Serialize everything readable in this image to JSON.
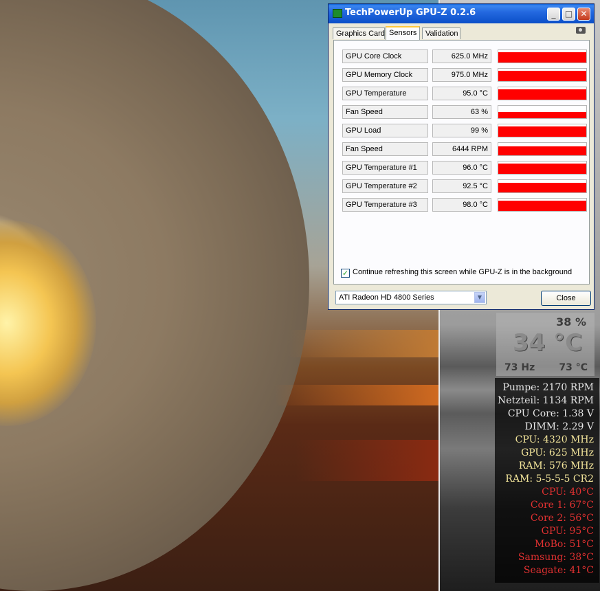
{
  "window": {
    "title": "TechPowerUp GPU-Z 0.2.6",
    "tabs": [
      "Graphics Card",
      "Sensors",
      "Validation"
    ],
    "active_tab": "Sensors",
    "sensors": [
      {
        "name": "GPU Core Clock",
        "value": "625.0 MHz",
        "level": 1.0
      },
      {
        "name": "GPU Memory Clock",
        "value": "975.0 MHz",
        "level": 1.0
      },
      {
        "name": "GPU Temperature",
        "value": "95.0 °C",
        "level": 1.0
      },
      {
        "name": "Fan Speed",
        "value": "63 %",
        "level": 0.6
      },
      {
        "name": "GPU Load",
        "value": "99 %",
        "level": 1.0
      },
      {
        "name": "Fan Speed",
        "value": "6444 RPM",
        "level": 0.85
      },
      {
        "name": "GPU Temperature #1",
        "value": "96.0 °C",
        "level": 1.0
      },
      {
        "name": "GPU Temperature #2",
        "value": "92.5 °C",
        "level": 0.9
      },
      {
        "name": "GPU Temperature #3",
        "value": "98.0 °C",
        "level": 1.0
      }
    ],
    "refresh_checkbox": {
      "label": "Continue refreshing this screen while GPU-Z is in the background",
      "checked": true
    },
    "gpu_select": "ATI Radeon HD 4800 Series",
    "close_label": "Close",
    "graph_color": "#ff0000"
  },
  "gadget": {
    "percent": "38 %",
    "temp": "34 °C",
    "hz": "73 Hz",
    "temp2": "73 °C"
  },
  "stats": [
    {
      "text": "Pumpe: 2170 RPM",
      "color": "white"
    },
    {
      "text": "Netzteil: 1134 RPM",
      "color": "white"
    },
    {
      "text": "CPU Core: 1.38 V",
      "color": "white"
    },
    {
      "text": "DIMM: 2.29 V",
      "color": "white"
    },
    {
      "text": "CPU: 4320 MHz",
      "color": "yellow"
    },
    {
      "text": "GPU: 625 MHz",
      "color": "yellow"
    },
    {
      "text": "RAM: 576 MHz",
      "color": "yellow"
    },
    {
      "text": "RAM: 5-5-5-5 CR2",
      "color": "yellow"
    },
    {
      "text": "CPU: 40°C",
      "color": "red"
    },
    {
      "text": "Core 1: 67°C",
      "color": "red"
    },
    {
      "text": "Core 2: 56°C",
      "color": "red"
    },
    {
      "text": "GPU: 95°C",
      "color": "red"
    },
    {
      "text": "MoBo: 51°C",
      "color": "red"
    },
    {
      "text": "Samsung: 38°C",
      "color": "red"
    },
    {
      "text": "Seagate: 41°C",
      "color": "red"
    }
  ]
}
